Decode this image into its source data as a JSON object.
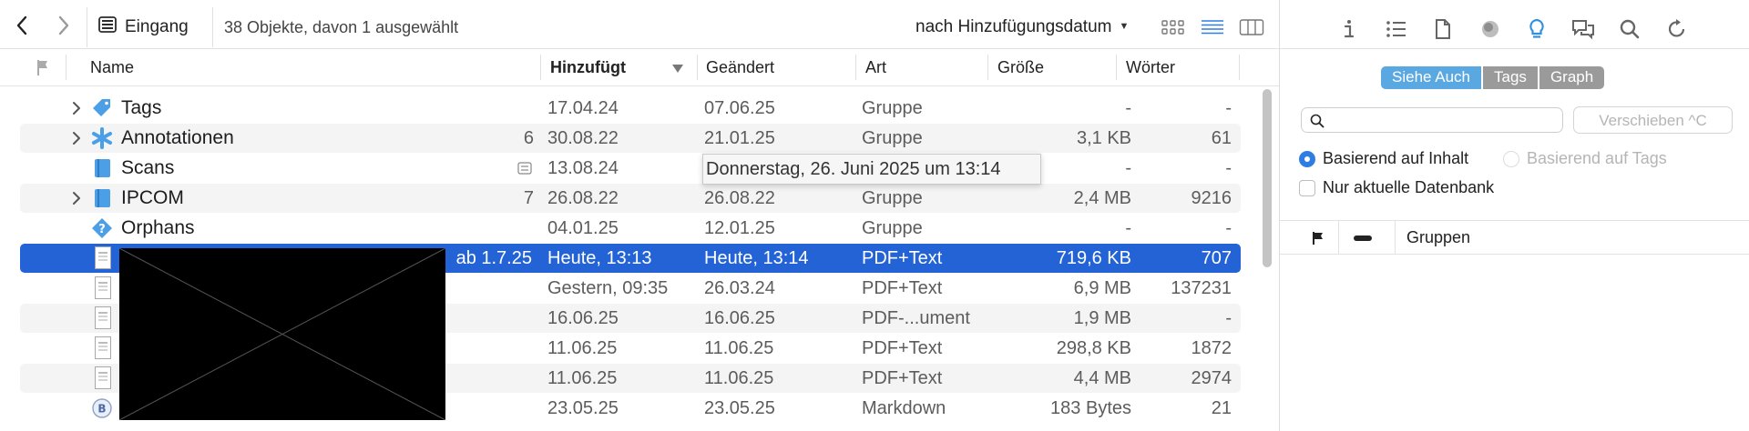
{
  "toolbar": {
    "back_icon": "chevron-left-icon",
    "forward_icon": "chevron-right-icon",
    "location_icon": "inbox-icon",
    "location": "Eingang",
    "status": "38 Objekte, davon 1 ausgewählt",
    "sort": "nach Hinzufügungsdatum",
    "views": [
      "grid-view-icon",
      "list-view-icon",
      "column-view-icon"
    ],
    "accent": "#2463d6"
  },
  "columns": {
    "name": "Name",
    "added": "Hinzufügt",
    "modified": "Geändert",
    "kind": "Art",
    "size": "Größe",
    "words": "Wörter"
  },
  "rows": [
    {
      "expandable": true,
      "icon": "tag-icon",
      "name": "Tags",
      "count": "",
      "added": "17.04.24",
      "modified": "07.06.25",
      "kind": "Gruppe",
      "size": "-",
      "words": "-"
    },
    {
      "expandable": true,
      "icon": "asterisk-icon",
      "name": "Annotationen",
      "count": "6",
      "added": "30.08.22",
      "modified": "21.01.25",
      "kind": "Gruppe",
      "size": "3,1 KB",
      "words": "61"
    },
    {
      "expandable": false,
      "icon": "book-icon",
      "name": "Scans",
      "count": "",
      "added": "13.08.24",
      "modified": "",
      "kind": "",
      "size": "-",
      "words": "-"
    },
    {
      "expandable": true,
      "icon": "book-icon",
      "name": "IPCOM",
      "count": "7",
      "added": "26.08.22",
      "modified": "26.08.22",
      "kind": "Gruppe",
      "size": "2,4 MB",
      "words": "9216"
    },
    {
      "expandable": false,
      "icon": "question-diamond-icon",
      "name": "Orphans",
      "count": "",
      "added": "04.01.25",
      "modified": "12.01.25",
      "kind": "Gruppe",
      "size": "-",
      "words": "-"
    },
    {
      "expandable": false,
      "icon": "document-icon",
      "name": "ab 1.7.25",
      "count": "",
      "added": "Heute, 13:13",
      "modified": "Heute, 13:14",
      "kind": "PDF+Text",
      "size": "719,6 KB",
      "words": "707"
    },
    {
      "expandable": false,
      "icon": "document-icon",
      "name": "",
      "count": "",
      "added": "Gestern, 09:35",
      "modified": "26.03.24",
      "kind": "PDF+Text",
      "size": "6,9 MB",
      "words": "137231"
    },
    {
      "expandable": false,
      "icon": "document-icon",
      "name": "",
      "count": "",
      "added": "16.06.25",
      "modified": "16.06.25",
      "kind": "PDF-...ument",
      "size": "1,9 MB",
      "words": "-"
    },
    {
      "expandable": false,
      "icon": "document-icon",
      "name": "",
      "count": "",
      "added": "11.06.25",
      "modified": "11.06.25",
      "kind": "PDF+Text",
      "size": "298,8 KB",
      "words": "1872"
    },
    {
      "expandable": false,
      "icon": "document-icon",
      "name": "",
      "count": "",
      "added": "11.06.25",
      "modified": "11.06.25",
      "kind": "PDF+Text",
      "size": "4,4 MB",
      "words": "2974"
    },
    {
      "expandable": false,
      "icon": "markdown-icon",
      "name": "",
      "count": "",
      "added": "23.05.25",
      "modified": "23.05.25",
      "kind": "Markdown",
      "size": "183 Bytes",
      "words": "21"
    }
  ],
  "tooltip": "Donnerstag, 26. Juni 2025 um 13:14",
  "inspector": {
    "tabs": [
      {
        "label": "Siehe Auch",
        "active": true
      },
      {
        "label": "Tags",
        "active": false
      },
      {
        "label": "Graph",
        "active": false
      }
    ],
    "tab_accent": "#59a8e2",
    "search_placeholder": "",
    "move_button": "Verschieben ^C",
    "radio_content": "Basierend auf Inhalt",
    "radio_tags": "Basierend auf Tags",
    "checkbox": "Nur aktuelle Datenbank",
    "list_header": "Gruppen",
    "toolbar_icons": [
      "info-icon",
      "list-icon",
      "document-icon",
      "circle-icon",
      "lightbulb-icon",
      "comments-icon",
      "search-icon",
      "reload-icon"
    ]
  }
}
